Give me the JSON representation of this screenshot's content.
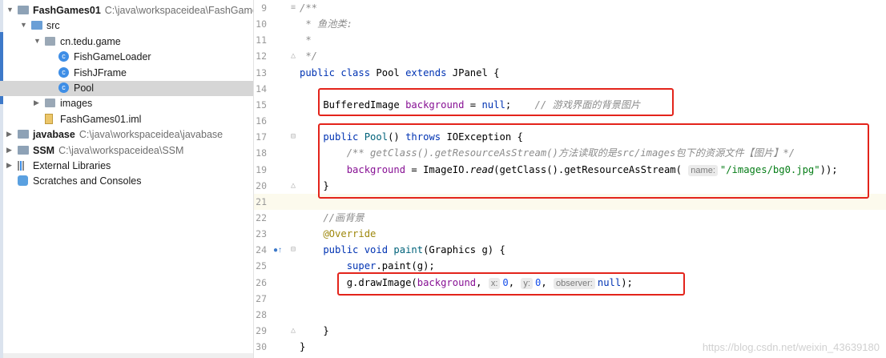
{
  "tree": {
    "items": [
      {
        "arrow": "▼",
        "icon": "folder",
        "name": "FashGames01",
        "path": "C:\\java\\workspaceidea\\FashGame",
        "bold": true,
        "indent": 0
      },
      {
        "arrow": "▼",
        "icon": "folder-blue",
        "name": "src",
        "path": "",
        "bold": false,
        "indent": 1
      },
      {
        "arrow": "▼",
        "icon": "package",
        "name": "cn.tedu.game",
        "path": "",
        "bold": false,
        "indent": 2
      },
      {
        "arrow": "",
        "icon": "class",
        "name": "FishGameLoader",
        "path": "",
        "bold": false,
        "indent": 3
      },
      {
        "arrow": "",
        "icon": "class",
        "name": "FishJFrame",
        "path": "",
        "bold": false,
        "indent": 3
      },
      {
        "arrow": "",
        "icon": "class",
        "name": "Pool",
        "path": "",
        "bold": false,
        "indent": 3,
        "selected": true
      },
      {
        "arrow": "▶",
        "icon": "package",
        "name": "images",
        "path": "",
        "bold": false,
        "indent": 2
      },
      {
        "arrow": "",
        "icon": "file",
        "name": "FashGames01.iml",
        "path": "",
        "bold": false,
        "indent": 2
      },
      {
        "arrow": "▶",
        "icon": "folder",
        "name": "javabase",
        "path": "C:\\java\\workspaceidea\\javabase",
        "bold": true,
        "indent": 0
      },
      {
        "arrow": "▶",
        "icon": "folder",
        "name": "SSM",
        "path": "C:\\java\\workspaceidea\\SSM",
        "bold": true,
        "indent": 0
      },
      {
        "arrow": "▶",
        "icon": "library",
        "name": "External Libraries",
        "path": "",
        "bold": false,
        "indent": 0
      },
      {
        "arrow": "",
        "icon": "scratch",
        "name": "Scratches and Consoles",
        "path": "",
        "bold": false,
        "indent": 0
      }
    ]
  },
  "editor": {
    "current_line": "21",
    "lines": [
      {
        "num": "9",
        "fold": "≡",
        "tokens": [
          [
            "cm",
            "/**"
          ]
        ]
      },
      {
        "num": "10",
        "tokens": [
          [
            "cm",
            " * 鱼池类:"
          ]
        ]
      },
      {
        "num": "11",
        "tokens": [
          [
            "cm",
            " *"
          ]
        ]
      },
      {
        "num": "12",
        "fold": "△",
        "tokens": [
          [
            "cm",
            " */"
          ]
        ]
      },
      {
        "num": "13",
        "tokens": [
          [
            "kw",
            "public class "
          ],
          [
            "ty",
            "Pool "
          ],
          [
            "kw",
            "extends "
          ],
          [
            "ty",
            "JPanel {"
          ]
        ]
      },
      {
        "num": "14",
        "tokens": []
      },
      {
        "num": "15",
        "tokens": [
          [
            "ty",
            "    BufferedImage "
          ],
          [
            "fld",
            "background"
          ],
          [
            "ty",
            " = "
          ],
          [
            "nul",
            "null"
          ],
          [
            "ty",
            ";    "
          ],
          [
            "cm",
            "// 游戏界面的背景图片"
          ]
        ]
      },
      {
        "num": "16",
        "tokens": []
      },
      {
        "num": "17",
        "fold": "⊟",
        "tokens": [
          [
            "kw",
            "    public "
          ],
          [
            "mth",
            "Pool"
          ],
          [
            "ty",
            "() "
          ],
          [
            "kw",
            "throws "
          ],
          [
            "ty",
            "IOException {"
          ]
        ]
      },
      {
        "num": "18",
        "tokens": [
          [
            "cm",
            "        /** getClass().getResourceAsStream()方法读取的是src/images包下的资源文件【图片】*/"
          ]
        ]
      },
      {
        "num": "19",
        "tokens": [
          [
            "fld",
            "        background"
          ],
          [
            "ty",
            " = ImageIO."
          ],
          [
            "stat",
            "read"
          ],
          [
            "ty",
            "(getClass().getResourceAsStream( "
          ],
          [
            "hint",
            "name:"
          ],
          [
            "str",
            "\"/images/bg0.jpg\""
          ],
          [
            "ty",
            "));"
          ]
        ]
      },
      {
        "num": "20",
        "fold": "△",
        "tokens": [
          [
            "ty",
            "    }"
          ]
        ]
      },
      {
        "num": "21",
        "tokens": []
      },
      {
        "num": "22",
        "tokens": [
          [
            "cm",
            "    //画背景"
          ]
        ]
      },
      {
        "num": "23",
        "tokens": [
          [
            "ann",
            "    @Override"
          ]
        ]
      },
      {
        "num": "24",
        "fold": "⊟",
        "tokens": [
          [
            "kw",
            "    public void "
          ],
          [
            "mth",
            "paint"
          ],
          [
            "ty",
            "(Graphics g) {"
          ]
        ]
      },
      {
        "num": "25",
        "tokens": [
          [
            "kw",
            "        super"
          ],
          [
            "ty",
            ".paint(g);"
          ]
        ]
      },
      {
        "num": "26",
        "tokens": [
          [
            "ty",
            "        g.drawImage("
          ],
          [
            "fld",
            "background"
          ],
          [
            "ty",
            ", "
          ],
          [
            "hint",
            "x:"
          ],
          [
            "num",
            "0"
          ],
          [
            "ty",
            ", "
          ],
          [
            "hint",
            "y:"
          ],
          [
            "num",
            "0"
          ],
          [
            "ty",
            ", "
          ],
          [
            "hint",
            "observer:"
          ],
          [
            "nul",
            "null"
          ],
          [
            "ty",
            ");"
          ]
        ]
      },
      {
        "num": "27",
        "tokens": []
      },
      {
        "num": "28",
        "tokens": []
      },
      {
        "num": "29",
        "fold": "△",
        "tokens": [
          [
            "ty",
            "    }"
          ]
        ]
      },
      {
        "num": "30",
        "tokens": [
          [
            "ty",
            "}"
          ]
        ]
      }
    ],
    "override_marker": "●↑"
  },
  "watermark": "https://blog.csdn.net/weixin_43639180",
  "colors": {
    "highlight_box": "#e3241b",
    "keyword": "#0033b3",
    "field": "#871094",
    "string": "#067d17",
    "comment": "#8c8c8c",
    "selection": "#d6d6d6"
  }
}
